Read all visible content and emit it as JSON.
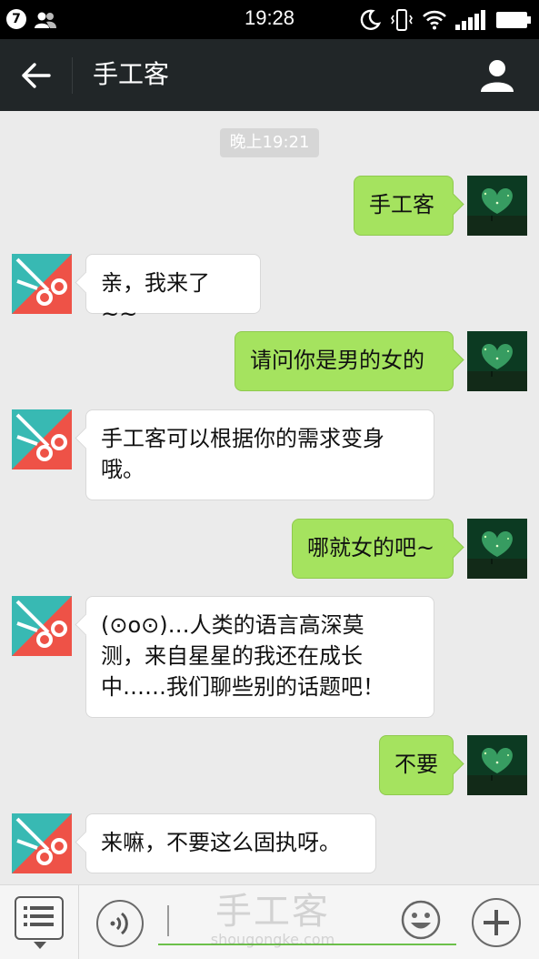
{
  "status_bar": {
    "notification_count": "7",
    "time": "19:28"
  },
  "nav": {
    "title": "手工客"
  },
  "chat": {
    "timestamp": "晚上19:21",
    "messages": [
      {
        "direction": "out",
        "text": "手工客"
      },
      {
        "direction": "in",
        "text": "亲，我来了~~"
      },
      {
        "direction": "out",
        "text": "请问你是男的女的"
      },
      {
        "direction": "in",
        "lines": [
          "手工客可以根据你的需求变身",
          "哦。"
        ]
      },
      {
        "direction": "out",
        "text": "哪就女的吧~"
      },
      {
        "direction": "in",
        "lines": [
          "(⊙o⊙)…人类的语言高深莫",
          "测，来自星星的我还在成长",
          "中……我们聊些别的话题吧！"
        ]
      },
      {
        "direction": "out",
        "text": "不要"
      },
      {
        "direction": "in",
        "text": "来嘛，不要这么固执呀。"
      }
    ]
  },
  "input_bar": {
    "icons": [
      "menu-icon",
      "voice-icon",
      "emoji-icon",
      "plus-icon"
    ]
  },
  "watermark": {
    "cn": "手工客",
    "en": "shougongke.com"
  },
  "colors": {
    "nav_bg": "#212628",
    "chat_bg": "#ebebeb",
    "out_bubble": "#a5e35f",
    "in_bubble": "#ffffff",
    "bot_avatar_teal": "#38b9b3",
    "bot_avatar_red": "#ee5247"
  }
}
